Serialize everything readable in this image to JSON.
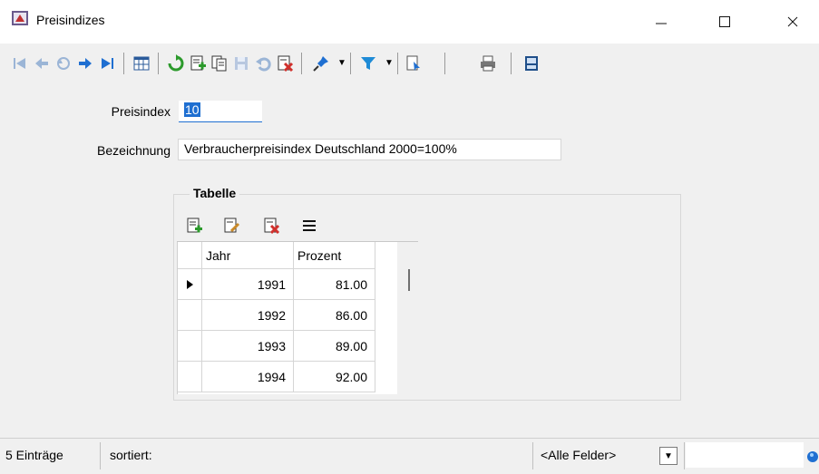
{
  "window": {
    "title": "Preisindizes"
  },
  "colors": {
    "selection": "#cde8ff",
    "accent_blue": "#1f6fd1",
    "green": "#2c9a2c",
    "red": "#d0312d"
  },
  "form": {
    "preisindex_label": "Preisindex",
    "preisindex_value": "10",
    "bezeichnung_label": "Bezeichnung",
    "bezeichnung_value": "Verbraucherpreisindex Deutschland 2000=100%"
  },
  "table": {
    "title": "Tabelle",
    "columns": [
      "Jahr",
      "Prozent"
    ],
    "rows": [
      {
        "jahr": "1991",
        "prozent": "81.00"
      },
      {
        "jahr": "1992",
        "prozent": "86.00"
      },
      {
        "jahr": "1993",
        "prozent": "89.00"
      },
      {
        "jahr": "1994",
        "prozent": "92.00"
      }
    ]
  },
  "status": {
    "count": "5 Einträge",
    "sort": "sortiert:",
    "field_filter": "<Alle Felder>"
  }
}
